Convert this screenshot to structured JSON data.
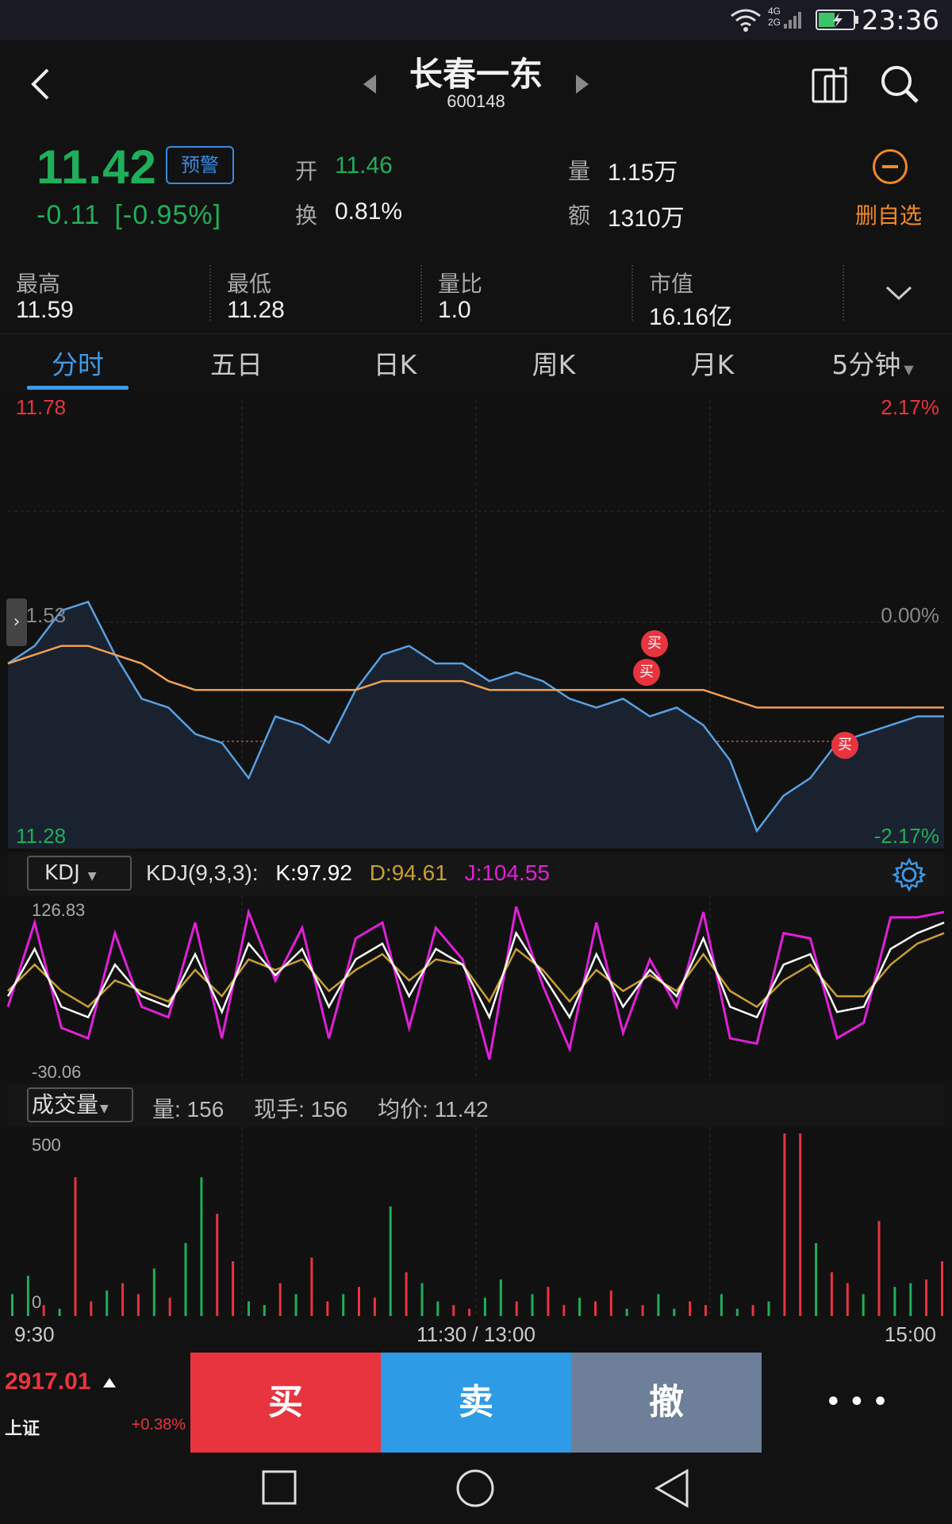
{
  "status": {
    "time": "23:36",
    "network_top": "4G",
    "network_bottom": "2G"
  },
  "header": {
    "title": "长春一东",
    "code": "600148"
  },
  "quote": {
    "price": "11.42",
    "alert_label": "预警",
    "change": "-0.11",
    "change_pct": "[-0.95%]",
    "open_label": "开",
    "open_value": "11.46",
    "turnover_label": "换",
    "turnover_value": "0.81%",
    "volume_label": "量",
    "volume_value": "1.15万",
    "amount_label": "额",
    "amount_value": "1310万",
    "remove_watchlist_label": "删自选"
  },
  "stats": [
    {
      "label": "最高",
      "value": "11.59"
    },
    {
      "label": "最低",
      "value": "11.28"
    },
    {
      "label": "量比",
      "value": "1.0"
    },
    {
      "label": "市值",
      "value": "16.16亿"
    }
  ],
  "tabs": [
    "分时",
    "五日",
    "日K",
    "周K",
    "月K",
    "5分钟"
  ],
  "price_chart": {
    "top_price": "11.78",
    "mid_price": "11.53",
    "bottom_price": "11.28",
    "top_pct": "2.17%",
    "mid_pct": "0.00%",
    "bottom_pct": "-2.17%",
    "buy_marker": "买"
  },
  "kdj": {
    "selector": "KDJ",
    "params": "KDJ(9,3,3):",
    "k": "K:97.92",
    "d": "D:94.61",
    "j": "J:104.55",
    "top": "126.83",
    "bottom": "-30.06"
  },
  "volume": {
    "selector": "成交量",
    "vol": "量: 156",
    "current": "现手: 156",
    "avg": "均价: 11.42",
    "top": "500",
    "bottom": "0"
  },
  "time_axis": {
    "start": "9:30",
    "mid": "11:30 / 13:00",
    "end": "15:00"
  },
  "bottom": {
    "index_value": "2917.01",
    "index_name": "上证",
    "index_change": "+0.38%",
    "buy": "买",
    "sell": "卖",
    "cancel": "撤",
    "more": "• • •"
  },
  "colors": {
    "up": "#e8343f",
    "down": "#1fae5a",
    "accent": "#3c9ae8",
    "price_line": "#5aa0e0",
    "avg_line": "#f0a050",
    "k_line": "#ffffff",
    "d_line": "#c8a030",
    "j_line": "#e020d8"
  },
  "chart_data": [
    {
      "type": "line",
      "title": "",
      "ylim": [
        11.28,
        11.78
      ],
      "series": [
        {
          "values": [
            11.49,
            11.51,
            11.55,
            11.56,
            11.5,
            11.45,
            11.44,
            11.41,
            11.4,
            11.36,
            11.43,
            11.42,
            11.4,
            11.46,
            11.5,
            11.51,
            11.49,
            11.49,
            11.47,
            11.48,
            11.47,
            11.45,
            11.44,
            11.45,
            11.43,
            11.44,
            11.42,
            11.38,
            11.3,
            11.34,
            11.36,
            11.4,
            11.41,
            11.42,
            11.43,
            11.43
          ]
        },
        {
          "values": [
            11.49,
            11.5,
            11.51,
            11.51,
            11.5,
            11.49,
            11.47,
            11.46,
            11.46,
            11.46,
            11.46,
            11.46,
            11.46,
            11.46,
            11.47,
            11.47,
            11.47,
            11.47,
            11.46,
            11.46,
            11.46,
            11.46,
            11.46,
            11.46,
            11.46,
            11.46,
            11.46,
            11.45,
            11.44,
            11.44,
            11.44,
            11.44,
            11.44,
            11.44,
            11.44,
            11.44
          ]
        }
      ]
    },
    {
      "type": "line",
      "title": "",
      "ylim": [
        -30.06,
        126.83
      ],
      "series": [
        {
          "values": [
            40,
            85,
            30,
            20,
            70,
            40,
            30,
            80,
            25,
            90,
            60,
            85,
            30,
            75,
            90,
            40,
            85,
            70,
            20,
            100,
            60,
            20,
            80,
            30,
            65,
            40,
            95,
            30,
            20,
            70,
            80,
            25,
            30,
            85,
            100,
            110
          ]
        },
        {
          "values": [
            45,
            70,
            45,
            30,
            55,
            45,
            35,
            65,
            40,
            75,
            65,
            75,
            45,
            65,
            80,
            55,
            75,
            70,
            35,
            85,
            65,
            35,
            65,
            45,
            60,
            45,
            80,
            45,
            30,
            55,
            70,
            40,
            40,
            70,
            90,
            100
          ]
        },
        {
          "values": [
            30,
            110,
            10,
            0,
            100,
            30,
            20,
            110,
            0,
            120,
            55,
            105,
            0,
            95,
            110,
            10,
            105,
            75,
            -20,
            125,
            50,
            -10,
            110,
            5,
            75,
            30,
            120,
            0,
            -5,
            100,
            95,
            0,
            15,
            115,
            115,
            120
          ]
        }
      ]
    },
    {
      "type": "bar",
      "title": "",
      "ylim": [
        0,
        500
      ],
      "values": [
        60,
        110,
        30,
        20,
        380,
        40,
        70,
        90,
        60,
        130,
        50,
        200,
        380,
        280,
        150,
        40,
        30,
        90,
        60,
        160,
        40,
        60,
        80,
        50,
        300,
        120,
        90,
        40,
        30,
        20,
        50,
        100,
        40,
        60,
        80,
        30,
        50,
        40,
        70,
        20,
        30,
        60,
        20,
        40,
        30,
        60,
        20,
        30,
        40,
        500,
        520,
        200,
        120,
        90,
        60,
        260,
        80,
        90,
        100,
        150
      ]
    }
  ]
}
